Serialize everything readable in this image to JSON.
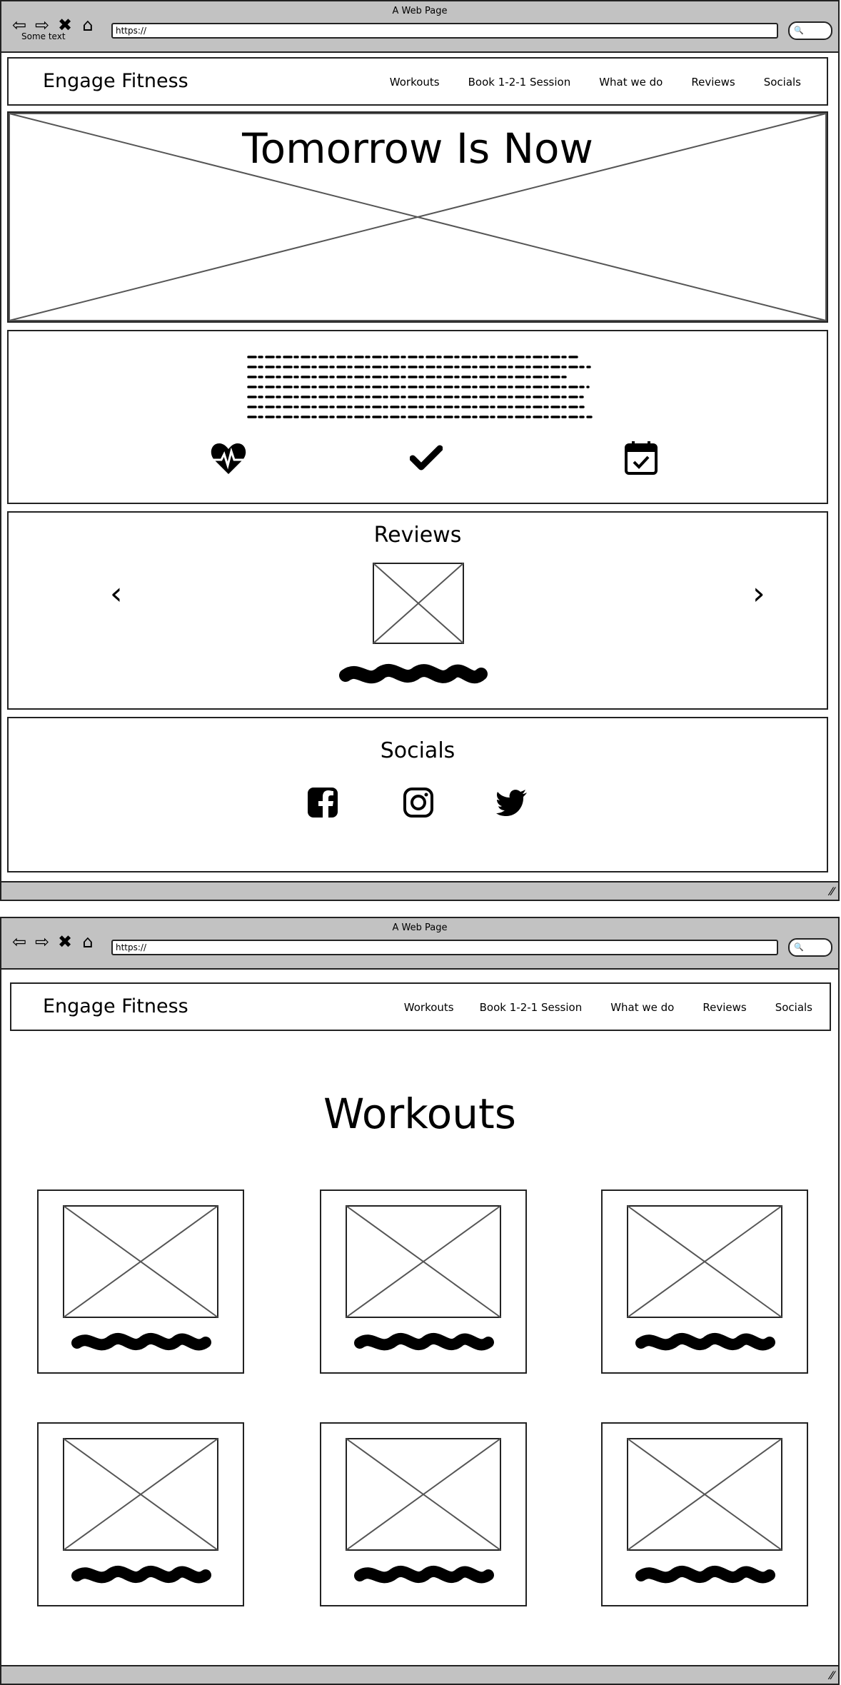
{
  "window1": {
    "title": "A Web Page",
    "url": "https://",
    "overlay_text": "Some text"
  },
  "window2": {
    "title": "A Web Page",
    "url": "https://"
  },
  "nav": {
    "brand": "Engage Fitness",
    "items": [
      "Workouts",
      "Book 1-2-1 Session",
      "What we do",
      "Reviews",
      "Socials"
    ]
  },
  "hero": {
    "title": "Tomorrow Is Now"
  },
  "about": {
    "icons": [
      "heartbeat-icon",
      "check-icon",
      "calendar-check-icon"
    ]
  },
  "reviews": {
    "heading": "Reviews"
  },
  "socials": {
    "heading": "Socials",
    "icons": [
      "facebook-icon",
      "instagram-icon",
      "twitter-icon"
    ]
  },
  "workouts": {
    "heading": "Workouts",
    "card_count": 6
  }
}
